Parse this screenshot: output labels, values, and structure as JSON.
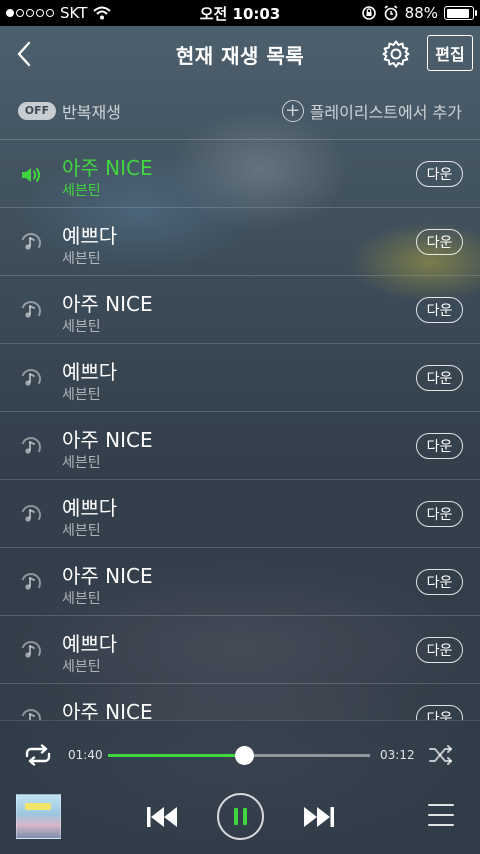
{
  "status_bar": {
    "carrier": "SKT",
    "time": "오전 10:03",
    "battery_percent": "88%",
    "battery_level": 0.88,
    "signal_dots_filled": 1,
    "signal_dots_total": 5
  },
  "header": {
    "title": "현재 재생 목록",
    "edit_label": "편집"
  },
  "options": {
    "repeat_badge": "OFF",
    "repeat_label": "반복재생",
    "add_playlist_label": "플레이리스트에서 추가"
  },
  "tracks": [
    {
      "title": "아주 NICE",
      "artist": "세븐틴",
      "down_label": "다운",
      "active": true
    },
    {
      "title": "예쁘다",
      "artist": "세븐틴",
      "down_label": "다운",
      "active": false
    },
    {
      "title": "아주 NICE",
      "artist": "세븐틴",
      "down_label": "다운",
      "active": false
    },
    {
      "title": "예쁘다",
      "artist": "세븐틴",
      "down_label": "다운",
      "active": false
    },
    {
      "title": "아주 NICE",
      "artist": "세븐틴",
      "down_label": "다운",
      "active": false
    },
    {
      "title": "예쁘다",
      "artist": "세븐틴",
      "down_label": "다운",
      "active": false
    },
    {
      "title": "아주 NICE",
      "artist": "세븐틴",
      "down_label": "다운",
      "active": false
    },
    {
      "title": "예쁘다",
      "artist": "세븐틴",
      "down_label": "다운",
      "active": false
    },
    {
      "title": "아주 NICE",
      "artist": "",
      "down_label": "다운",
      "active": false
    }
  ],
  "player": {
    "current_time": "01:40",
    "total_time": "03:12",
    "progress_fraction": 0.52
  },
  "colors": {
    "accent": "#41d63f"
  },
  "icons": {
    "back": "chevron-left-icon",
    "settings": "gear-icon",
    "add": "plus-circle-icon",
    "now_playing": "speaker-icon",
    "track": "music-note-icon",
    "repeat": "repeat-icon",
    "shuffle": "shuffle-icon",
    "previous": "skip-previous-icon",
    "pause": "pause-icon",
    "next": "skip-next-icon",
    "menu": "hamburger-menu-icon"
  }
}
